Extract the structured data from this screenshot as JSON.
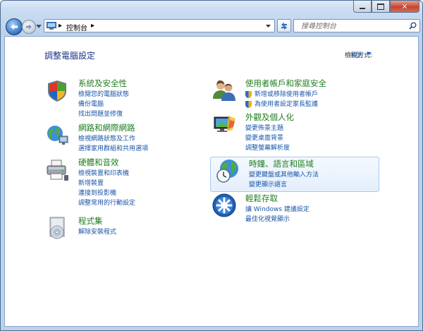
{
  "window": {
    "buttons": {
      "minimize": "minimize",
      "maximize": "maximize",
      "close": "close"
    }
  },
  "nav": {
    "breadcrumb": [
      "控制台"
    ],
    "search_placeholder": "搜尋控制台"
  },
  "header": {
    "title": "調整電腦設定",
    "view_by_label": "檢視方式:",
    "view_by_value": "類別"
  },
  "categories": [
    {
      "title": "系統及安全性",
      "icon": "shield-icon",
      "links": [
        "檢閱您的電腦狀態",
        "備份電腦",
        "找出問題並修復"
      ]
    },
    {
      "title": "網路和網際網路",
      "icon": "network-globe-icon",
      "links": [
        "檢視網路狀態及工作",
        "選擇家用群組和共用選項"
      ]
    },
    {
      "title": "硬體和音效",
      "icon": "printer-icon",
      "links": [
        "檢視裝置和印表機",
        "新增裝置",
        "連接到投影機",
        "調整常用的行動設定"
      ]
    },
    {
      "title": "程式集",
      "icon": "programs-icon",
      "links": [
        "解除安裝程式"
      ]
    },
    {
      "title": "使用者帳戶和家庭安全",
      "icon": "users-icon",
      "links": [
        "新增或移除使用者帳戶",
        "為使用者設定家長監護"
      ]
    },
    {
      "title": "外觀及個人化",
      "icon": "display-icon",
      "links": [
        "變更佈景主題",
        "變更桌面背景",
        "調整螢幕解析度"
      ]
    },
    {
      "title": "時鐘、語言和區域",
      "icon": "clock-globe-icon",
      "links": [
        "變更鍵盤或其他輸入方法",
        "變更顯示語言"
      ]
    },
    {
      "title": "輕鬆存取",
      "icon": "ease-of-access-icon",
      "links": [
        "讓 Windows 建議設定",
        "最佳化視覺顯示"
      ]
    }
  ]
}
